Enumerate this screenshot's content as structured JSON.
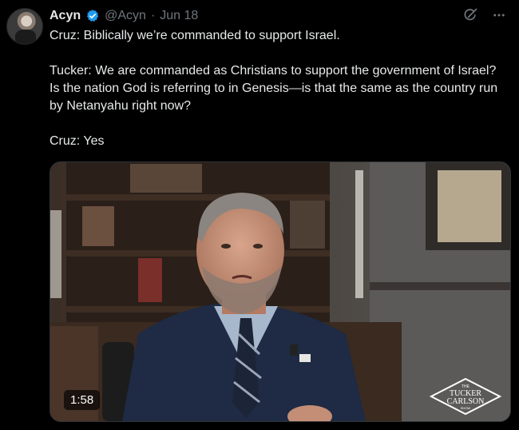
{
  "author": {
    "name": "Acyn",
    "handle": "@Acyn",
    "separator": "·",
    "date": "Jun 18"
  },
  "tweet": {
    "lines": [
      "Cruz: Biblically we’re commanded to support Israel.",
      "Tucker: We are commanded as Christians to support the government of Israel? Is the nation God is referring to in Genesis—is that the same as the country run by Netanyahu right now?",
      "Cruz: Yes"
    ]
  },
  "media": {
    "duration": "1:58",
    "logo": {
      "line1": "THE",
      "line2": "TUCKER",
      "line3": "CARLSON",
      "line4": "SHOW"
    }
  },
  "icons": [
    "verified-badge-icon",
    "grok-icon",
    "more-icon"
  ],
  "colors": {
    "verified": "#1d9bf0",
    "secondary_text": "#71767b"
  }
}
